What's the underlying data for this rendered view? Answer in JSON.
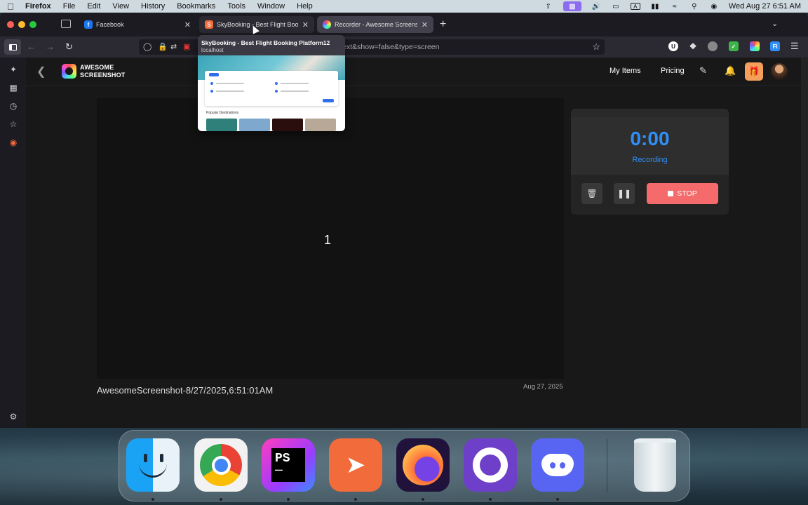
{
  "menubar": {
    "app_name": "Firefox",
    "items": [
      "File",
      "Edit",
      "View",
      "History",
      "Bookmarks",
      "Tools",
      "Window",
      "Help"
    ],
    "clock": "Wed Aug 27  6:51 AM",
    "status_icons": [
      "upload-icon",
      "screen-mirror-icon",
      "volume-icon",
      "display-icon",
      "input-a-icon",
      "battery-icon",
      "wifi-icon",
      "spotlight-search-icon",
      "control-center-icon"
    ]
  },
  "tabs": [
    {
      "title": "Facebook",
      "favicon": "f",
      "favicon_color": "#1877f2"
    },
    {
      "title": "SkyBooking - Best Flight Booking Platform12",
      "favicon": "S",
      "favicon_color": "#f26b3a"
    },
    {
      "title": "Recorder - Awesome Screenshot",
      "favicon": "",
      "favicon_color": "#7a5cff"
    }
  ],
  "urlbar": {
    "visible_text": "=ext&show=false&type=screen"
  },
  "tab_preview": {
    "title": "SkyBooking - Best Flight Booking Platform12",
    "subtitle": "localhost",
    "section_heading": "Popular Destinations"
  },
  "app": {
    "logo_line1": "AWESOME",
    "logo_line2": "SCREENSHOT",
    "nav": {
      "my_items": "My Items",
      "pricing": "Pricing"
    }
  },
  "recording": {
    "countdown": "1",
    "timer": "0:00",
    "status": "Recording",
    "stop_label": "STOP",
    "file_name": "AwesomeScreenshot-8/27/2025,6:51:01AM",
    "date": "Aug 27, 2025"
  },
  "dock": {
    "apps": [
      "Finder",
      "Google Chrome",
      "PhpStorm",
      "Postman",
      "Firefox",
      "GitHub Desktop",
      "Discord",
      "Trash"
    ]
  },
  "colors": {
    "accent_blue": "#2f8ff7",
    "stop_red": "#f56b6b",
    "gift_orange": "#f5a05a"
  }
}
